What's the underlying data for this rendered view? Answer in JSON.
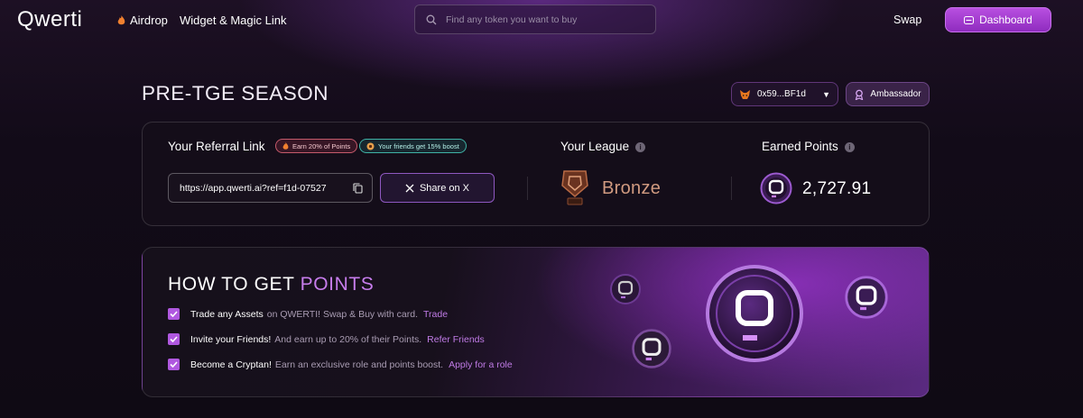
{
  "header": {
    "logo": "Qwerti",
    "nav": {
      "airdrop": "Airdrop",
      "widget": "Widget & Magic Link"
    },
    "search_placeholder": "Find any token you want to buy",
    "swap": "Swap",
    "dashboard": "Dashboard"
  },
  "season": {
    "title": "PRE-TGE SEASON",
    "wallet": "0x59...BF1d",
    "role": "Ambassador"
  },
  "referral": {
    "label": "Your Referral Link",
    "badge_earn": "Earn 20% of Points",
    "badge_boost": "Your friends get 15% boost",
    "link": "https://app.qwerti.ai?ref=f1d-07527",
    "share": "Share on X",
    "league_label": "Your League",
    "league": "Bronze",
    "points_label": "Earned Points",
    "points": "2,727.91"
  },
  "how_to": {
    "title_main": "HOW TO GET",
    "title_accent": "POINTS",
    "tasks": [
      {
        "bold": "Trade any Assets",
        "rest": "on QWERTI! Swap & Buy with card.",
        "link": "Trade"
      },
      {
        "bold": "Invite your Friends!",
        "rest": "And earn up to 20% of their Points.",
        "link": "Refer Friends"
      },
      {
        "bold": "Become a Cryptan!",
        "rest": "Earn an exclusive role and points boost.",
        "link": "Apply for a role"
      }
    ]
  },
  "colors": {
    "accent": "#b058e0",
    "bronze": "#d09a80"
  }
}
